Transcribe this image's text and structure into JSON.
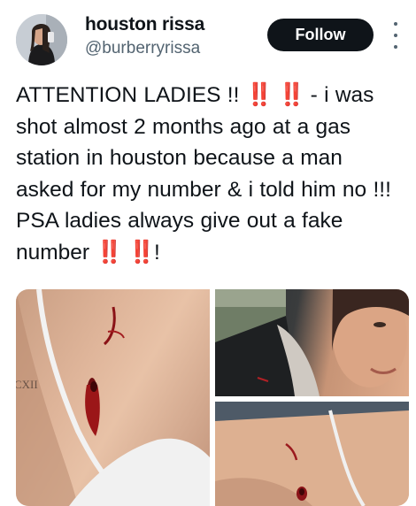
{
  "user": {
    "display_name": "houston rissa",
    "handle": "@burberryrissa",
    "avatar_icon": "profile-photo"
  },
  "follow_label": "Follow",
  "more_icon": "vertical-ellipsis-icon",
  "tweet": {
    "part1": "ATTENTION LADIES !! ",
    "emoji": "‼️",
    "part2": " - i was shot almost 2 months ago at a gas station in houston because a man asked for my number & i told him no !!! PSA ladies always give out a fake number ",
    "part3": "!"
  },
  "photos": {
    "main_tattoo_text": "CXII"
  },
  "colors": {
    "follow_bg": "#0f1419",
    "emoji_red": "#e0245e",
    "handle_gray": "#536471"
  }
}
